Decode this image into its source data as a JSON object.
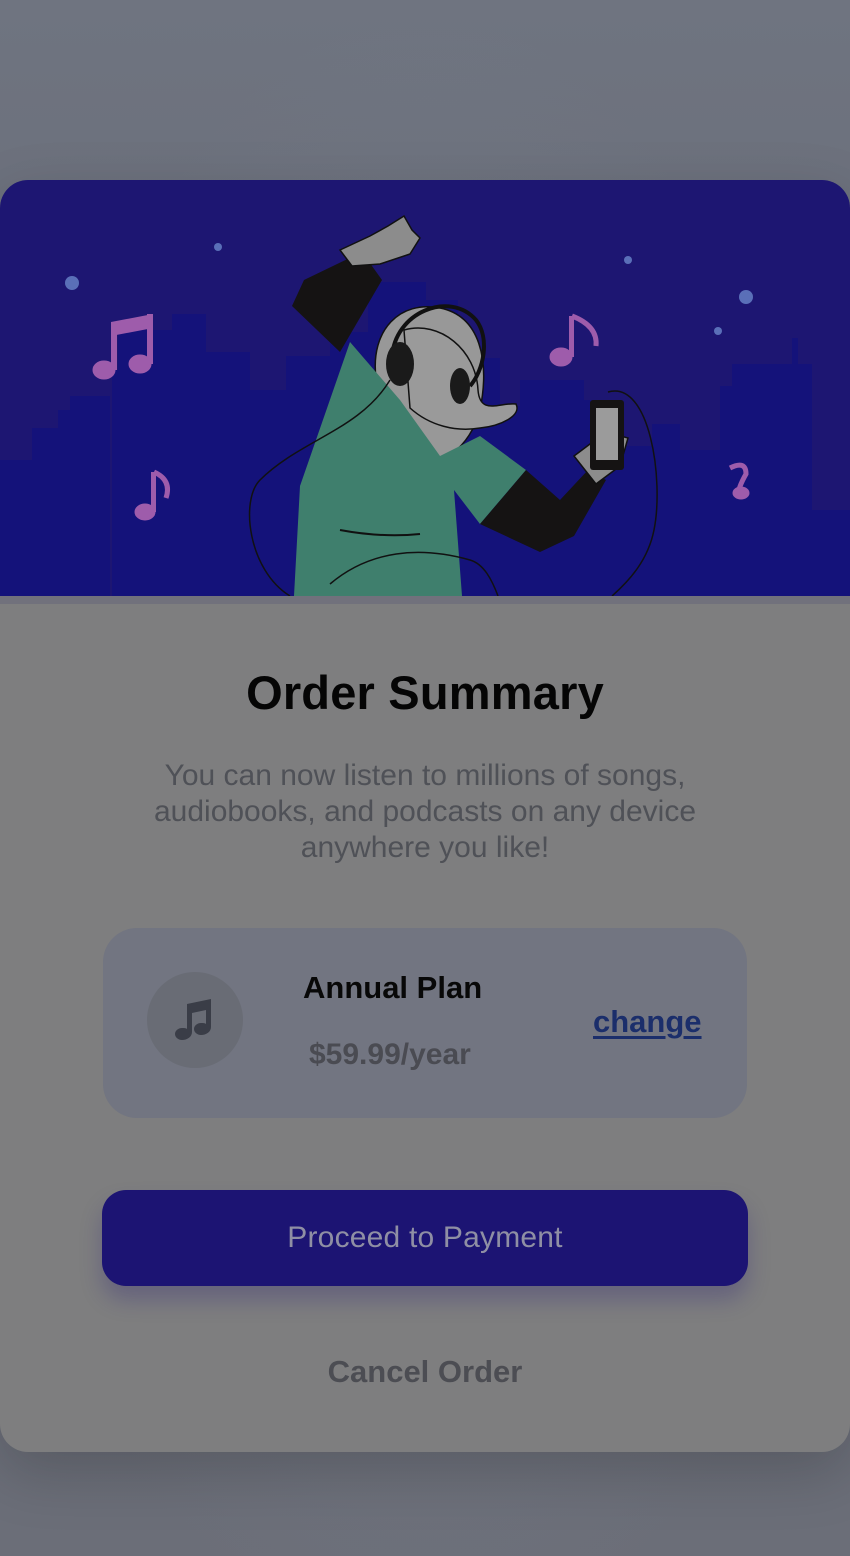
{
  "card": {
    "title": "Order Summary",
    "subtitle": "You can now listen to millions of songs, audiobooks, and podcasts on any device anywhere you like!"
  },
  "plan": {
    "name": "Annual Plan",
    "price": "$59.99/year",
    "change_label": "change",
    "icon": "music-note-icon"
  },
  "actions": {
    "primary_label": "Proceed to Payment",
    "secondary_label": "Cancel Order"
  },
  "colors": {
    "hero_bg": "#1d1672",
    "button_bg": "#1c1473",
    "card_bg": "#7e7e7f",
    "plan_bg": "#727581",
    "link": "#1b2e6b",
    "shirt": "#3f7f6d",
    "notes": "#9e5cab"
  }
}
